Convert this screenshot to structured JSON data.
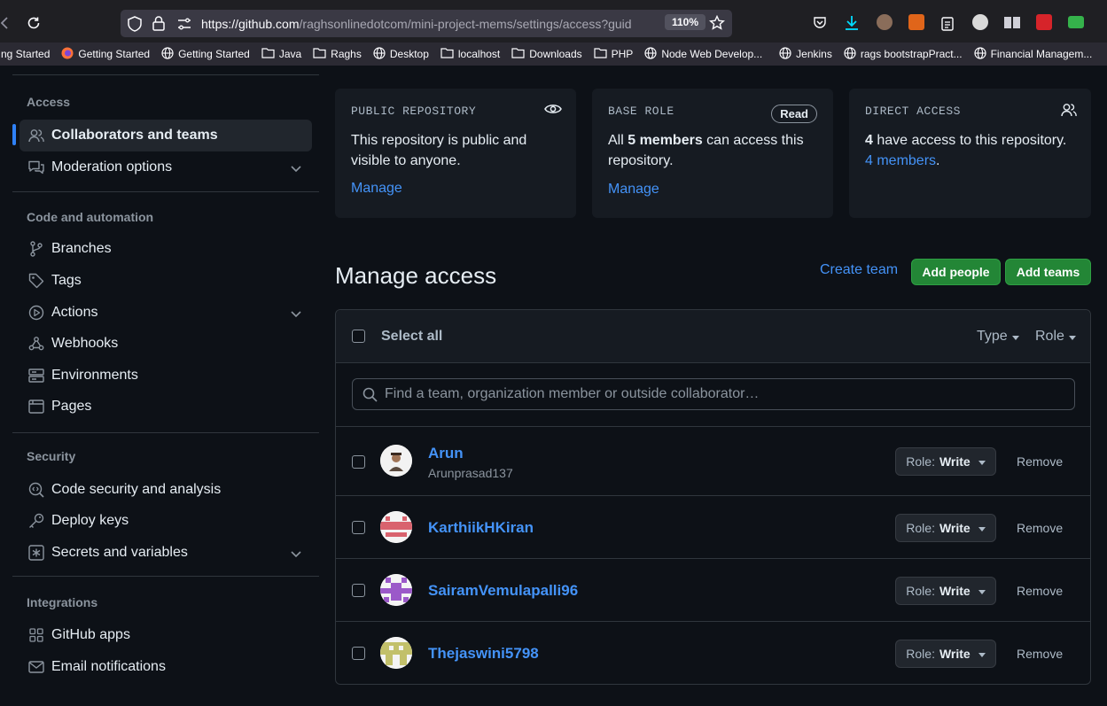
{
  "browser": {
    "url_domain": "https://github.com",
    "url_path": "/raghsonlinedotcom/mini-project-mems/settings/access?guid",
    "zoom": "110%",
    "bookmarks": [
      {
        "label": "ng Started",
        "icon": "none"
      },
      {
        "label": "Getting Started",
        "icon": "firefox-icon"
      },
      {
        "label": "Getting Started",
        "icon": "globe-icon"
      },
      {
        "label": "Java",
        "icon": "folder-icon"
      },
      {
        "label": "Raghs",
        "icon": "folder-icon"
      },
      {
        "label": "Desktop",
        "icon": "globe-icon"
      },
      {
        "label": "localhost",
        "icon": "folder-icon"
      },
      {
        "label": "Downloads",
        "icon": "folder-icon"
      },
      {
        "label": "PHP",
        "icon": "folder-icon"
      },
      {
        "label": "Node Web Develop...",
        "icon": "globe-icon"
      },
      {
        "label": "Jenkins",
        "icon": "globe-icon"
      },
      {
        "label": "rags bootstrapPract...",
        "icon": "globe-icon"
      },
      {
        "label": "Financial Managem...",
        "icon": "globe-icon"
      }
    ]
  },
  "sidebar": {
    "sections": [
      {
        "heading": "Access",
        "items": [
          {
            "label": "Collaborators and teams",
            "icon": "people-icon",
            "active": true
          },
          {
            "label": "Moderation options",
            "icon": "comment-discussion-icon",
            "expandable": true
          }
        ]
      },
      {
        "heading": "Code and automation",
        "items": [
          {
            "label": "Branches",
            "icon": "git-branch-icon"
          },
          {
            "label": "Tags",
            "icon": "tag-icon"
          },
          {
            "label": "Actions",
            "icon": "play-icon",
            "expandable": true
          },
          {
            "label": "Webhooks",
            "icon": "webhook-icon"
          },
          {
            "label": "Environments",
            "icon": "server-icon"
          },
          {
            "label": "Pages",
            "icon": "browser-icon"
          }
        ]
      },
      {
        "heading": "Security",
        "items": [
          {
            "label": "Code security and analysis",
            "icon": "codescan-icon"
          },
          {
            "label": "Deploy keys",
            "icon": "key-icon"
          },
          {
            "label": "Secrets and variables",
            "icon": "key-asterisk-icon",
            "expandable": true
          }
        ]
      },
      {
        "heading": "Integrations",
        "items": [
          {
            "label": "GitHub apps",
            "icon": "apps-icon"
          },
          {
            "label": "Email notifications",
            "icon": "mail-icon"
          }
        ]
      }
    ]
  },
  "cards": {
    "public": {
      "title": "PUBLIC REPOSITORY",
      "text": "This repository is public and visible to anyone.",
      "link": "Manage"
    },
    "base_role": {
      "title": "BASE ROLE",
      "badge": "Read",
      "text_pre": "All ",
      "text_bold": "5 members",
      "text_post": " can access this repository.",
      "link": "Manage"
    },
    "direct": {
      "title": "DIRECT ACCESS",
      "text_bold": "4",
      "text_mid": " have access to this repository. ",
      "text_link": "4 members",
      "text_post": "."
    }
  },
  "manage": {
    "title": "Manage access",
    "create_team": "Create team",
    "add_people": "Add people",
    "add_teams": "Add teams",
    "select_all": "Select all",
    "filter_type": "Type",
    "filter_role": "Role",
    "search_placeholder": "Find a team, organization member or outside collaborator…"
  },
  "collaborators": [
    {
      "name": "Arun",
      "login": "Arunprasad137",
      "role_label": "Role:",
      "role": "Write",
      "remove": "Remove"
    },
    {
      "name": "KarthiikHKiran",
      "login": "",
      "role_label": "Role:",
      "role": "Write",
      "remove": "Remove"
    },
    {
      "name": "SairamVemulapalli96",
      "login": "",
      "role_label": "Role:",
      "role": "Write",
      "remove": "Remove"
    },
    {
      "name": "Thejaswini5798",
      "login": "",
      "role_label": "Role:",
      "role": "Write",
      "remove": "Remove"
    }
  ],
  "colors": {
    "accent": "#4493f8",
    "primary_button": "#238636",
    "background": "#0d1117"
  }
}
